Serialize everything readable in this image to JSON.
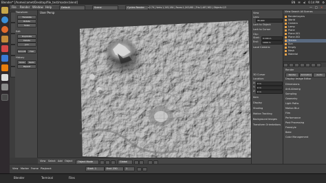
{
  "os": {
    "window_title": "Blender* [/home/comet/Desktop/file_test/master.blend]",
    "tray_items": [
      "EN",
      "✉",
      "◂)",
      "6:14 PM",
      "⚙"
    ]
  },
  "launcher": {
    "icons": [
      {
        "name": "files-icon",
        "color": "#c7a64a"
      },
      {
        "name": "chrome-icon",
        "color": "#3b8fd9"
      },
      {
        "name": "firefox-icon",
        "color": "#e36b2c"
      },
      {
        "name": "folder-icon",
        "color": "#c48a3a"
      },
      {
        "name": "terminal-icon",
        "color": "#e0e0e0"
      },
      {
        "name": "office-icon",
        "color": "#3a7bd5"
      },
      {
        "name": "software-icon",
        "color": "#d44747"
      },
      {
        "name": "blender-icon",
        "color": "#e87d0d"
      },
      {
        "name": "settings-icon",
        "color": "#8a8a8a"
      }
    ]
  },
  "header": {
    "menus": [
      "File",
      "Render",
      "Window",
      "Help"
    ],
    "layout_name": "Default",
    "scene_name": "Scene",
    "engine": "Cycles Render",
    "version_info": "v2.79 | Verts:1,245,184 | Faces:1,243,681 | Tris:2,487,362 | Objects:1/3",
    "window_controls": [
      "—",
      "□",
      "×"
    ]
  },
  "tool_panel": {
    "sections": [
      "Transform",
      "Edit",
      "History"
    ],
    "buttons": [
      "Translate",
      "Rotate",
      "Scale",
      "Duplicate",
      "Delete",
      "Join",
      "Smooth",
      "Flat",
      "Undo",
      "Redo",
      "Repeat"
    ]
  },
  "viewport": {
    "label": "User Persp",
    "footer_items": [
      "View",
      "Select",
      "Add",
      "Object",
      "Object Mode",
      "Global"
    ]
  },
  "n_panel": {
    "rows": [
      {
        "label": "View",
        "value": ""
      },
      {
        "label": "Lens:",
        "value": "35.000"
      },
      {
        "label": "Lock to Object:",
        "value": ""
      },
      {
        "label": "Lock to Cursor",
        "value": ""
      },
      {
        "label": "Clip:",
        "value": ""
      },
      {
        "label": "Start:",
        "value": "0.100 m"
      },
      {
        "label": "End:",
        "value": "1000 m"
      },
      {
        "label": "Local Camera:",
        "value": ""
      },
      {
        "label": "3D Cursor",
        "value": ""
      },
      {
        "label": "Location:",
        "value": ""
      },
      {
        "label": "X:",
        "value": "0 m"
      },
      {
        "label": "Y:",
        "value": "0 m"
      },
      {
        "label": "Z:",
        "value": "0 m"
      },
      {
        "label": "Item",
        "value": ""
      },
      {
        "label": "Display",
        "value": ""
      },
      {
        "label": "Shading",
        "value": ""
      },
      {
        "label": "Motion Tracking",
        "value": ""
      },
      {
        "label": "Background Images",
        "value": ""
      },
      {
        "label": "Transform Orientations",
        "value": ""
      }
    ]
  },
  "outliner": {
    "header": [
      "View",
      "Search",
      "All Scenes"
    ],
    "rows": [
      "RenderLayers",
      "World",
      "Camera",
      "Lamp",
      "Plane",
      "Plane.001",
      "Plane.002",
      "Terrain",
      "Sun",
      "Empty",
      "Mesh",
      "Material"
    ]
  },
  "properties": {
    "rows": [
      "Render",
      "Render  Animation",
      "Audio",
      "Display: Image Editor",
      "Dimensions",
      "Anti-Aliasing",
      "Sampling",
      "Geometry",
      "Light Paths",
      "Motion Blur",
      "Film",
      "Performance",
      "Post Processing",
      "Freestyle",
      "Bake",
      "Color Management"
    ],
    "buttons": [
      "Render",
      "Animation",
      "Audio"
    ]
  },
  "timeline": {
    "items": [
      "View",
      "Marker",
      "Frame",
      "Playback",
      "Start:",
      "1",
      "End:",
      "250",
      "1"
    ]
  },
  "taskbar": {
    "items": [
      "Blender",
      "Terminal",
      "Files"
    ]
  }
}
